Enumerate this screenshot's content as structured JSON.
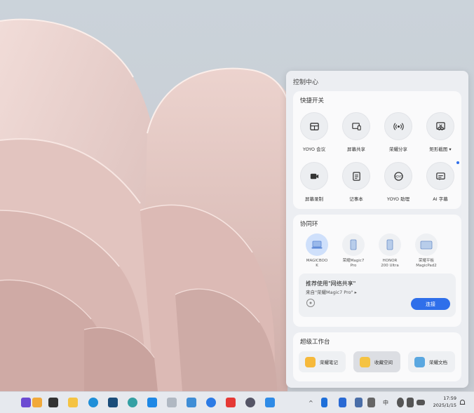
{
  "control_center": {
    "title": "控制中心",
    "shortcuts": {
      "title": "快捷开关",
      "items": [
        {
          "label": "YOYO 会议",
          "icon": "meeting-icon"
        },
        {
          "label": "屏幕共享",
          "icon": "screen-share-icon"
        },
        {
          "label": "荣耀分享",
          "icon": "honor-share-icon"
        },
        {
          "label": "矩形截图 ▾",
          "icon": "screenshot-icon"
        },
        {
          "label": "屏幕录制",
          "icon": "screen-record-icon"
        },
        {
          "label": "记事本",
          "icon": "notepad-icon"
        },
        {
          "label": "YOYO 助理",
          "icon": "assistant-icon"
        },
        {
          "label": "AI 字幕",
          "icon": "ai-subtitle-icon"
        }
      ]
    },
    "collaboration": {
      "title": "协同环",
      "devices": [
        {
          "label_1": "MAGICBOO",
          "label_2": "K",
          "icon": "laptop-icon"
        },
        {
          "label_1": "荣耀Magic7",
          "label_2": "Pro",
          "icon": "phone-icon"
        },
        {
          "label_1": "HONOR",
          "label_2": "200 Ultra",
          "icon": "phone-icon"
        },
        {
          "label_1": "荣耀平板",
          "label_2": "MagicPad2",
          "icon": "tablet-icon"
        }
      ],
      "recommend": {
        "title": "推荐使用\"网络共享\"",
        "subtitle": "来自\"荣耀Magic7 Pro\" ▸",
        "connect_label": "连接"
      }
    },
    "workbench": {
      "title": "超级工作台",
      "items": [
        {
          "label": "荣耀笔记",
          "color": "#f6b93b"
        },
        {
          "label": "收藏空间",
          "color": "#f5c343"
        },
        {
          "label": "荣耀文档",
          "color": "#5aa7e0"
        }
      ]
    }
  },
  "taskbar": {
    "tray_lang": "中",
    "time": "17:59",
    "date": "2025/1/15"
  },
  "colors": {
    "accent": "#2f6fea",
    "panel_bg": "#eceef2",
    "card_bg": "#fafafb"
  }
}
